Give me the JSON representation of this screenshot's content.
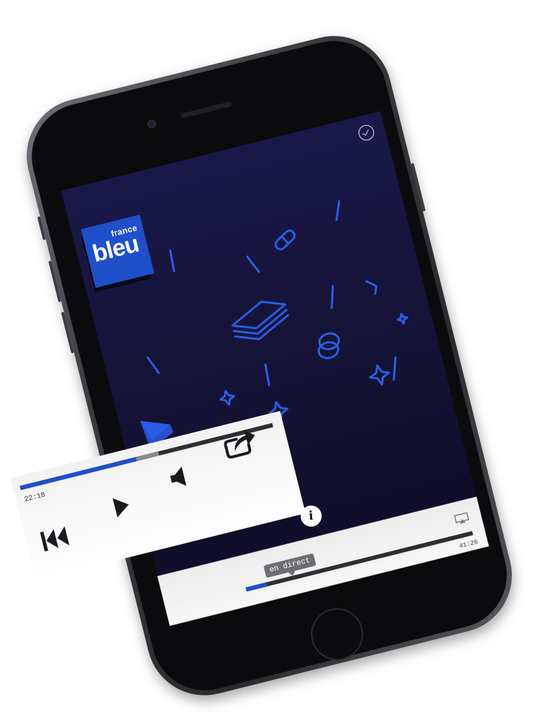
{
  "app": {
    "logo_small": "france",
    "logo_large": "bleu"
  },
  "header": {
    "timer_icon": "clock-check-icon"
  },
  "info": {
    "label": "i"
  },
  "player": {
    "live_badge": "en direct",
    "duration": "41:26",
    "elapsed": "22:18",
    "progress_fraction": 0.46,
    "buffer_fraction": 0.09,
    "live_fraction": 0.09
  },
  "controls": {
    "rewind_icon": "rewind-icon",
    "play_icon": "play-icon",
    "volume_icon": "speaker-icon",
    "share_icon": "share-icon",
    "airplay_icon": "airplay-icon"
  },
  "colors": {
    "brand_blue": "#1f4fc9",
    "screen_bg": "#141234",
    "art_stroke": "#2a5de6"
  }
}
